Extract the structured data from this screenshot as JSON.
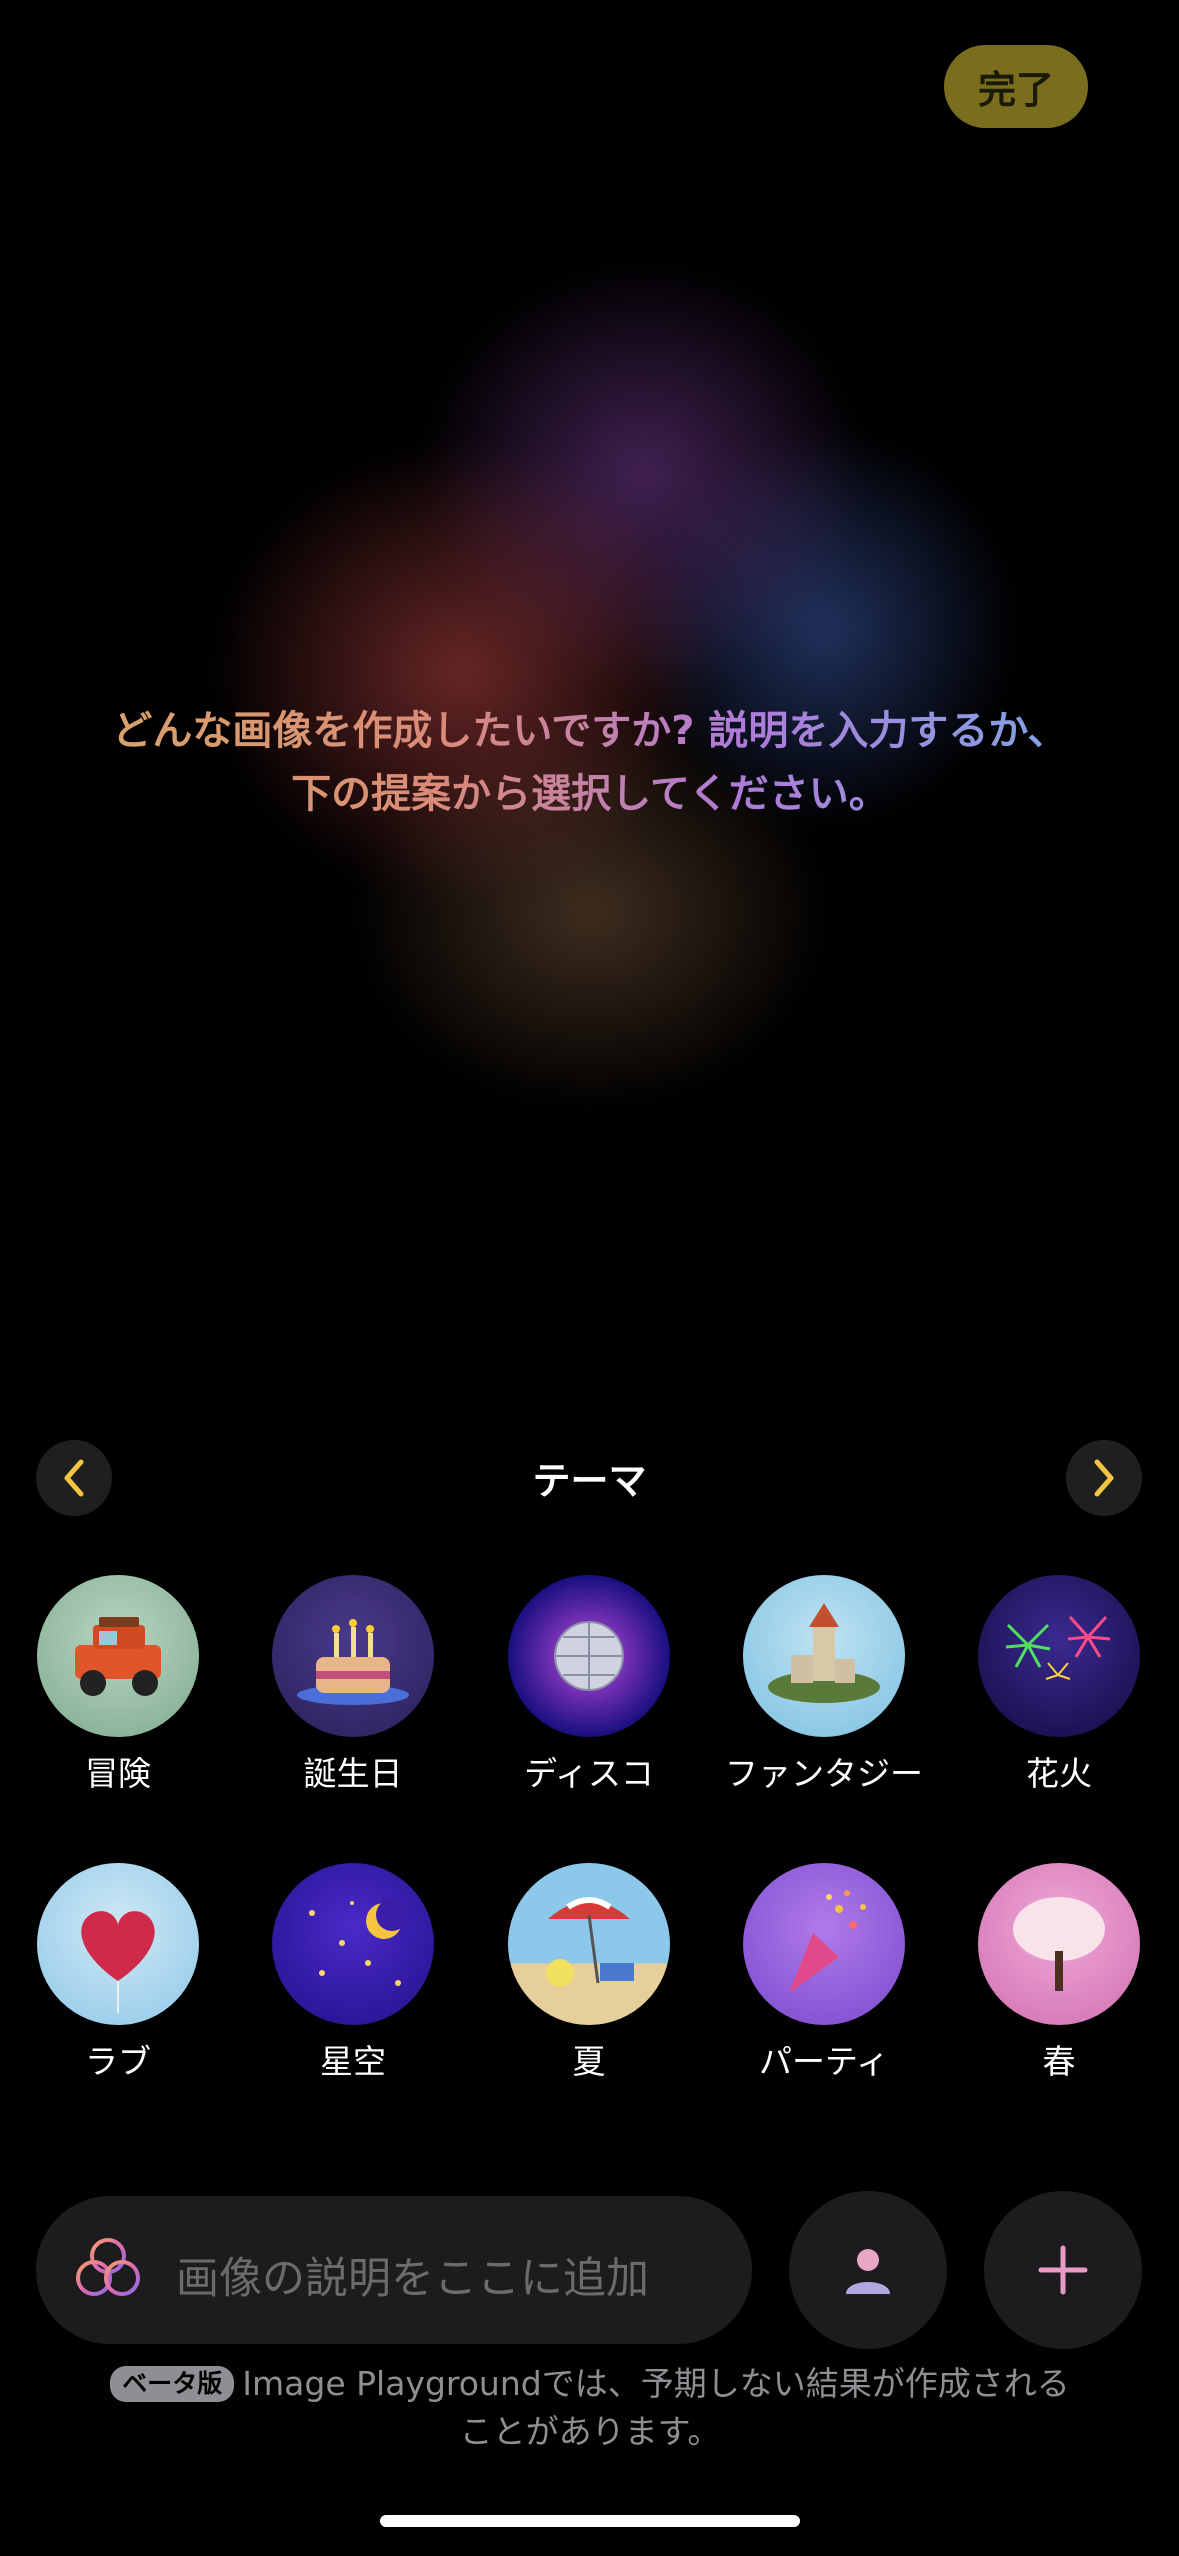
{
  "header": {
    "done_label": "完了"
  },
  "prompt_text": "どんな画像を作成したいですか? 説明を入力するか、下の提案から選択してください。",
  "themes": {
    "title": "テーマ",
    "items": [
      {
        "label": "冒険",
        "icon": "jeep-icon"
      },
      {
        "label": "誕生日",
        "icon": "birthday-cake-icon"
      },
      {
        "label": "ディスコ",
        "icon": "disco-ball-icon"
      },
      {
        "label": "ファンタジー",
        "icon": "castle-island-icon"
      },
      {
        "label": "花火",
        "icon": "fireworks-icon"
      },
      {
        "label": "ラブ",
        "icon": "heart-balloon-icon"
      },
      {
        "label": "星空",
        "icon": "moon-stars-icon"
      },
      {
        "label": "夏",
        "icon": "beach-umbrella-icon"
      },
      {
        "label": "パーティ",
        "icon": "party-popper-icon"
      },
      {
        "label": "春",
        "icon": "blossom-tree-icon"
      }
    ]
  },
  "search": {
    "placeholder": "画像の説明をここに追加"
  },
  "disclaimer": {
    "badge": "ベータ版",
    "text": "Image Playgroundでは、予期しない結果が作成されることがあります。"
  },
  "colors": {
    "accent_yellow": "#f5c542",
    "done_bg": "#7b6d1e",
    "control_bg": "#1c1c1e",
    "plus_color": "#e89bc6"
  }
}
